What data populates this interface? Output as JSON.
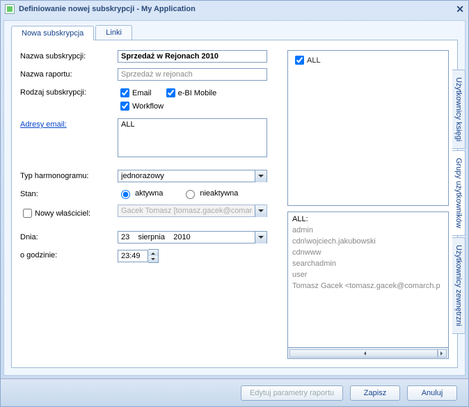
{
  "window": {
    "title": "Definiowanie nowej subskrypcji - My Application"
  },
  "tabs": {
    "main": "Nowa subskrypcja",
    "links": "Linki"
  },
  "labels": {
    "sub_name": "Nazwa subskrypcji:",
    "report_name": "Nazwa raportu:",
    "sub_type": "Rodzaj subskrypcji:",
    "emails": "Adresy email:",
    "schedule_type": "Typ harmonogramu:",
    "state": "Stan:",
    "new_owner": "Nowy właściciel:",
    "date": "Dnia:",
    "time": "o godzinie:"
  },
  "values": {
    "sub_name": "Sprzedaż w Rejonach 2010",
    "report_name": "Sprzedaż w rejonach",
    "emails_text": "ALL",
    "schedule_type": "jednorazowy",
    "owner": "Gacek Tomasz [tomasz.gacek@comarch.",
    "date": "23    sierpnia    2010",
    "time": "23:49"
  },
  "checks": {
    "email": "Email",
    "ebi": "e-BI Mobile",
    "workflow": "Workflow",
    "active": "aktywna",
    "inactive": "nieaktywna"
  },
  "tree": {
    "root": "ALL"
  },
  "list": {
    "title": "ALL:",
    "items": [
      "admin",
      "cdn\\wojciech.jakubowski",
      "cdnwww",
      "searchadmin",
      "user",
      "Tomasz Gacek <tomasz.gacek@comarch.p"
    ]
  },
  "sidetabs": {
    "t1": "Użytkownicy księgi",
    "t2": "Grupy użytkowników",
    "t3": "Użytkownicy zewnętrzni"
  },
  "footer": {
    "edit": "Edytuj parametry raportu",
    "save": "Zapisz",
    "cancel": "Anuluj"
  }
}
